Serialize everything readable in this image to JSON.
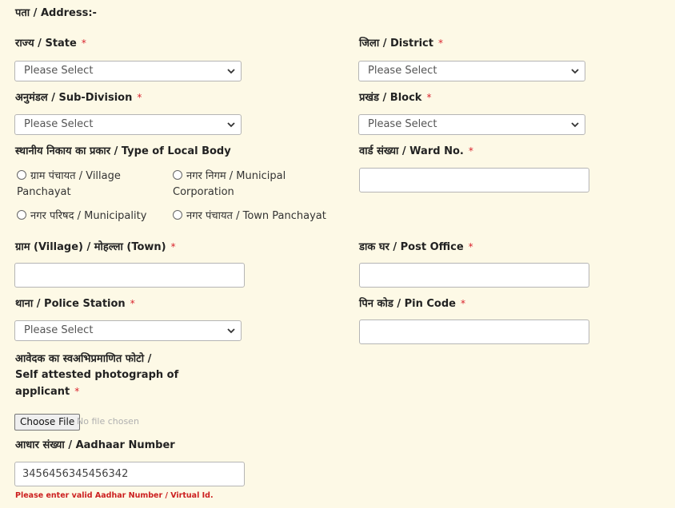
{
  "section_title": "पता / Address:-",
  "required_mark": "*",
  "fields": {
    "state": {
      "label": "राज्य / State",
      "value": "Please Select"
    },
    "district": {
      "label": "जिला / District",
      "value": "Please Select"
    },
    "subdivision": {
      "label": "अनुमंडल / Sub-Division",
      "value": "Please Select"
    },
    "block": {
      "label": "प्रखंड / Block",
      "value": "Please Select"
    },
    "local_body": {
      "label": "स्थानीय निकाय का प्रकार / Type of Local Body",
      "options": [
        {
          "line1": "ग्राम पंचायत / Village",
          "line2": "Panchayat"
        },
        {
          "line1": "नगर निगम / Municipal",
          "line2": "Corporation"
        },
        {
          "line1": "नगर परिषद / Municipality",
          "line2": ""
        },
        {
          "line1": "नगर पंचायत / Town Panchayat",
          "line2": ""
        }
      ]
    },
    "ward": {
      "label": "वार्ड संख्या / Ward No.",
      "value": ""
    },
    "village": {
      "label": "ग्राम (Village) / मोहल्ला (Town)",
      "value": ""
    },
    "post_office": {
      "label": "डाक घर / Post Office",
      "value": ""
    },
    "police_station": {
      "label": "थाना / Police Station",
      "value": "Please Select"
    },
    "pin_code": {
      "label": "पिन कोड / Pin Code",
      "value": ""
    },
    "photo": {
      "label_line1": "आवेदक का स्वअभिप्रमाणित फोटो /",
      "label_line2": "Self attested photograph of",
      "label_line3": "applicant",
      "button": "Choose File",
      "status": "No file chosen"
    },
    "aadhaar": {
      "label": "आधार संख्या / Aadhaar Number",
      "value": "3456456345456342",
      "error": "Please enter valid Aadhar Number / Virtual Id."
    }
  }
}
